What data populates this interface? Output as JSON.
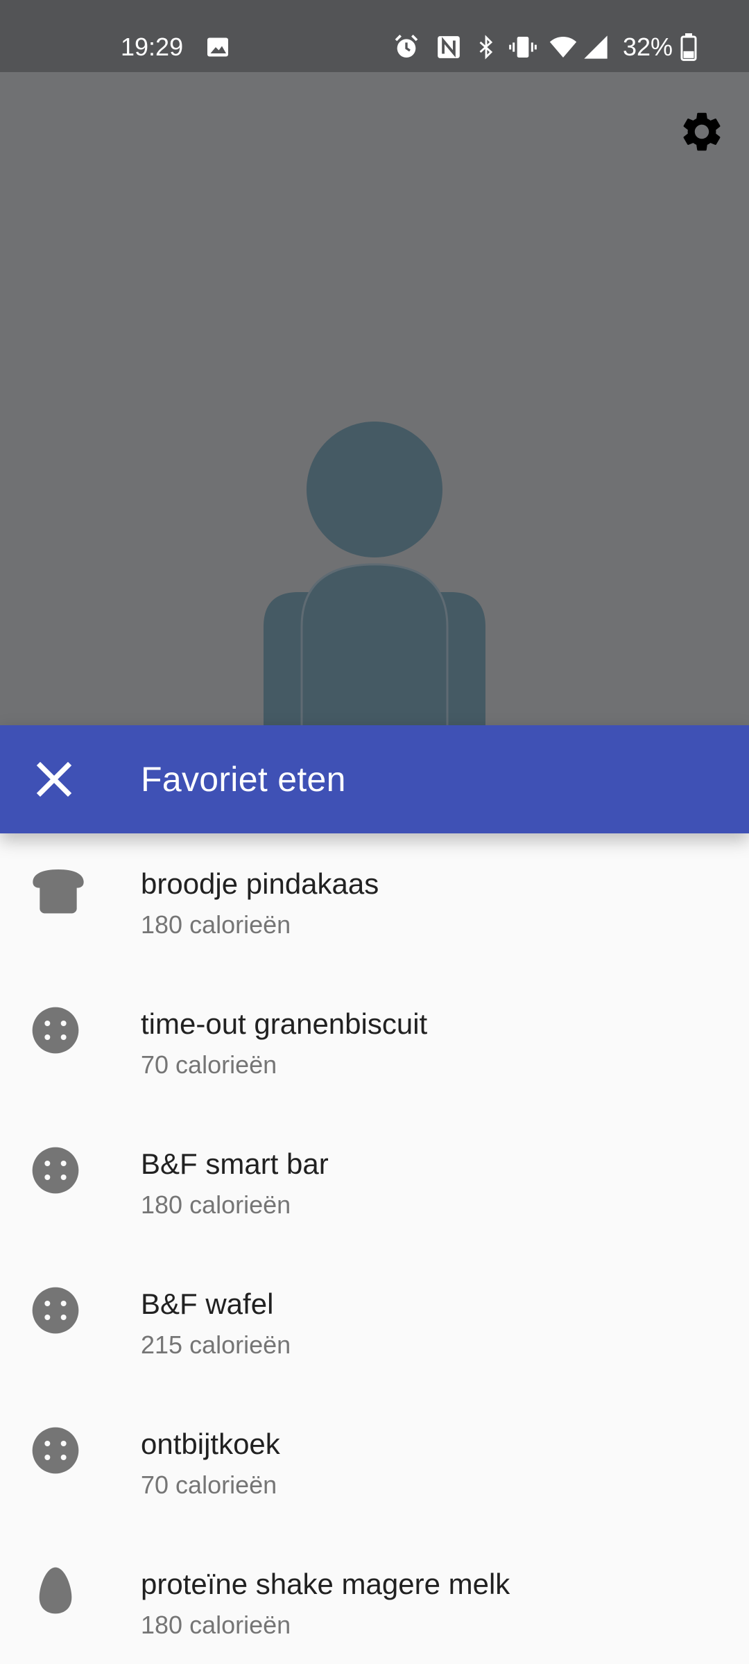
{
  "status_bar": {
    "time": "19:29",
    "battery": "32%",
    "icons": [
      "image-icon",
      "alarm-icon",
      "nfc-icon",
      "bluetooth-icon",
      "vibrate-icon",
      "wifi-icon",
      "signal-icon",
      "battery-icon"
    ]
  },
  "background": {
    "settings_icon": "gear-icon",
    "avatar_icon": "person-icon"
  },
  "sheet": {
    "title": "Favoriet eten",
    "close_icon": "close-icon"
  },
  "foods": [
    {
      "name": "broodje pindakaas",
      "calories": "180 calorieën",
      "icon": "bread-icon"
    },
    {
      "name": "time-out granenbiscuit",
      "calories": "70 calorieën",
      "icon": "cookie-icon"
    },
    {
      "name": "B&F smart bar",
      "calories": "180 calorieën",
      "icon": "cookie-icon"
    },
    {
      "name": "B&F wafel",
      "calories": "215 calorieën",
      "icon": "cookie-icon"
    },
    {
      "name": "ontbijtkoek",
      "calories": "70 calorieën",
      "icon": "cookie-icon"
    },
    {
      "name": "proteïne shake magere melk",
      "calories": "180 calorieën",
      "icon": "egg-icon"
    }
  ],
  "colors": {
    "accent": "#3f51b5",
    "status_bar": "#535456",
    "scrim": "#707173",
    "avatar": "#455a64",
    "icon_gray": "#757575"
  }
}
